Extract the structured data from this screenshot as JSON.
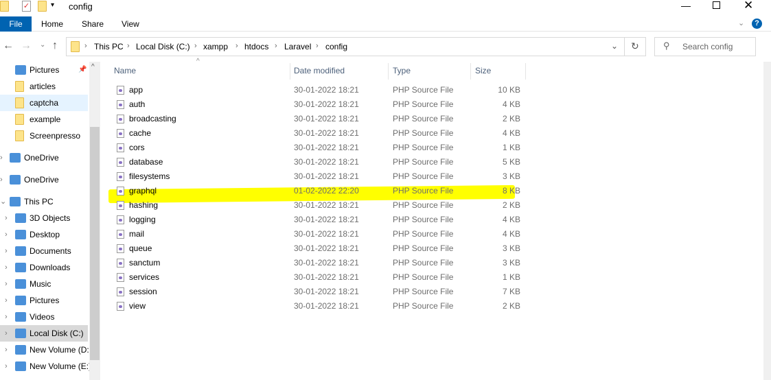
{
  "window": {
    "title": "config"
  },
  "ribbon": {
    "tabs": [
      "File",
      "Home",
      "Share",
      "View"
    ]
  },
  "address": {
    "crumbs": [
      "This PC",
      "Local Disk (C:)",
      "xampp",
      "htdocs",
      "Laravel",
      "config"
    ]
  },
  "search": {
    "placeholder": "Search config"
  },
  "sidebar": {
    "items": [
      {
        "label": "Pictures",
        "icon": "pictures-icon",
        "pinned": true
      },
      {
        "label": "articles",
        "icon": "folder-icon"
      },
      {
        "label": "captcha",
        "icon": "folder-icon",
        "selected": true
      },
      {
        "label": "example",
        "icon": "folder-icon"
      },
      {
        "label": "Screenpresso",
        "icon": "folder-icon"
      },
      {
        "label": "OneDrive",
        "icon": "onedrive-app-icon"
      },
      {
        "label": "OneDrive",
        "icon": "cloud-icon"
      },
      {
        "label": "This PC",
        "icon": "computer-icon"
      },
      {
        "label": "3D Objects",
        "icon": "cube-icon"
      },
      {
        "label": "Desktop",
        "icon": "desktop-icon"
      },
      {
        "label": "Documents",
        "icon": "document-icon"
      },
      {
        "label": "Downloads",
        "icon": "download-icon"
      },
      {
        "label": "Music",
        "icon": "music-icon"
      },
      {
        "label": "Pictures",
        "icon": "pictures-icon"
      },
      {
        "label": "Videos",
        "icon": "video-icon"
      },
      {
        "label": "Local Disk (C:)",
        "icon": "drive-icon",
        "active": true
      },
      {
        "label": "New Volume (D:)",
        "icon": "drive-icon"
      },
      {
        "label": "New Volume (E:)",
        "icon": "drive-icon"
      }
    ]
  },
  "columns": {
    "name": "Name",
    "date": "Date modified",
    "type": "Type",
    "size": "Size"
  },
  "files": [
    {
      "name": "app",
      "date": "30-01-2022 18:21",
      "type": "PHP Source File",
      "size": "10 KB"
    },
    {
      "name": "auth",
      "date": "30-01-2022 18:21",
      "type": "PHP Source File",
      "size": "4 KB"
    },
    {
      "name": "broadcasting",
      "date": "30-01-2022 18:21",
      "type": "PHP Source File",
      "size": "2 KB"
    },
    {
      "name": "cache",
      "date": "30-01-2022 18:21",
      "type": "PHP Source File",
      "size": "4 KB"
    },
    {
      "name": "cors",
      "date": "30-01-2022 18:21",
      "type": "PHP Source File",
      "size": "1 KB"
    },
    {
      "name": "database",
      "date": "30-01-2022 18:21",
      "type": "PHP Source File",
      "size": "5 KB"
    },
    {
      "name": "filesystems",
      "date": "30-01-2022 18:21",
      "type": "PHP Source File",
      "size": "3 KB"
    },
    {
      "name": "graphql",
      "date": "01-02-2022 22:20",
      "type": "PHP Source File",
      "size": "8 KB",
      "highlighted": true
    },
    {
      "name": "hashing",
      "date": "30-01-2022 18:21",
      "type": "PHP Source File",
      "size": "2 KB"
    },
    {
      "name": "logging",
      "date": "30-01-2022 18:21",
      "type": "PHP Source File",
      "size": "4 KB"
    },
    {
      "name": "mail",
      "date": "30-01-2022 18:21",
      "type": "PHP Source File",
      "size": "4 KB"
    },
    {
      "name": "queue",
      "date": "30-01-2022 18:21",
      "type": "PHP Source File",
      "size": "3 KB"
    },
    {
      "name": "sanctum",
      "date": "30-01-2022 18:21",
      "type": "PHP Source File",
      "size": "3 KB"
    },
    {
      "name": "services",
      "date": "30-01-2022 18:21",
      "type": "PHP Source File",
      "size": "1 KB"
    },
    {
      "name": "session",
      "date": "30-01-2022 18:21",
      "type": "PHP Source File",
      "size": "7 KB"
    },
    {
      "name": "view",
      "date": "30-01-2022 18:21",
      "type": "PHP Source File",
      "size": "2 KB"
    }
  ],
  "colors": {
    "accent": "#0063b1",
    "highlight": "#ffff00",
    "selected": "#e5f3ff"
  }
}
